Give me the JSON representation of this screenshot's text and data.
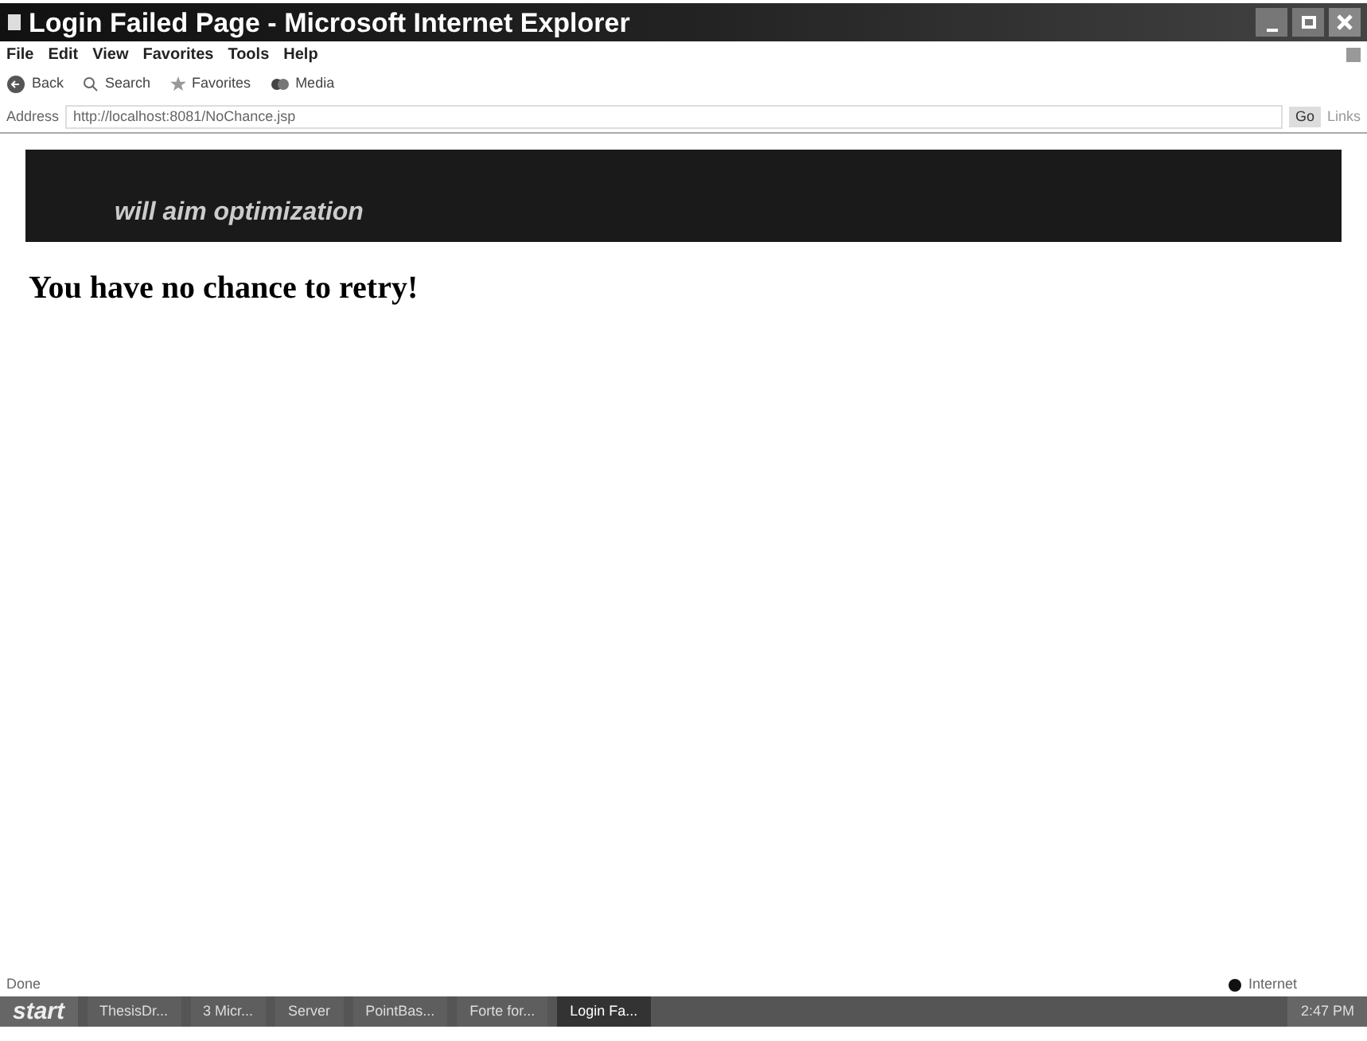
{
  "window": {
    "title": "Login Failed Page - Microsoft Internet Explorer"
  },
  "menu": [
    "File",
    "Edit",
    "View",
    "Favorites",
    "Tools",
    "Help"
  ],
  "toolbar": [
    {
      "kind": "back",
      "label": "Back"
    },
    {
      "kind": "search",
      "label": "Search"
    },
    {
      "kind": "favorites",
      "label": "Favorites"
    },
    {
      "kind": "media",
      "label": "Media"
    }
  ],
  "address_bar": {
    "label": "Address",
    "value": "http://localhost:8081/NoChance.jsp",
    "go": "Go",
    "links": "Links"
  },
  "page": {
    "banner": "will aim optimization",
    "heading": "You have no chance to retry!"
  },
  "status_bar": {
    "status": "Done",
    "zone": "Internet"
  },
  "taskbar": {
    "start": "start",
    "buttons": [
      {
        "label": "ThesisDr...",
        "selected": false
      },
      {
        "label": "3 Micr...",
        "selected": false
      },
      {
        "label": "Server",
        "selected": false
      },
      {
        "label": "PointBas...",
        "selected": false
      },
      {
        "label": "Forte for...",
        "selected": false
      },
      {
        "label": "Login Fa...",
        "selected": true
      }
    ],
    "clock": "2:47 PM"
  }
}
